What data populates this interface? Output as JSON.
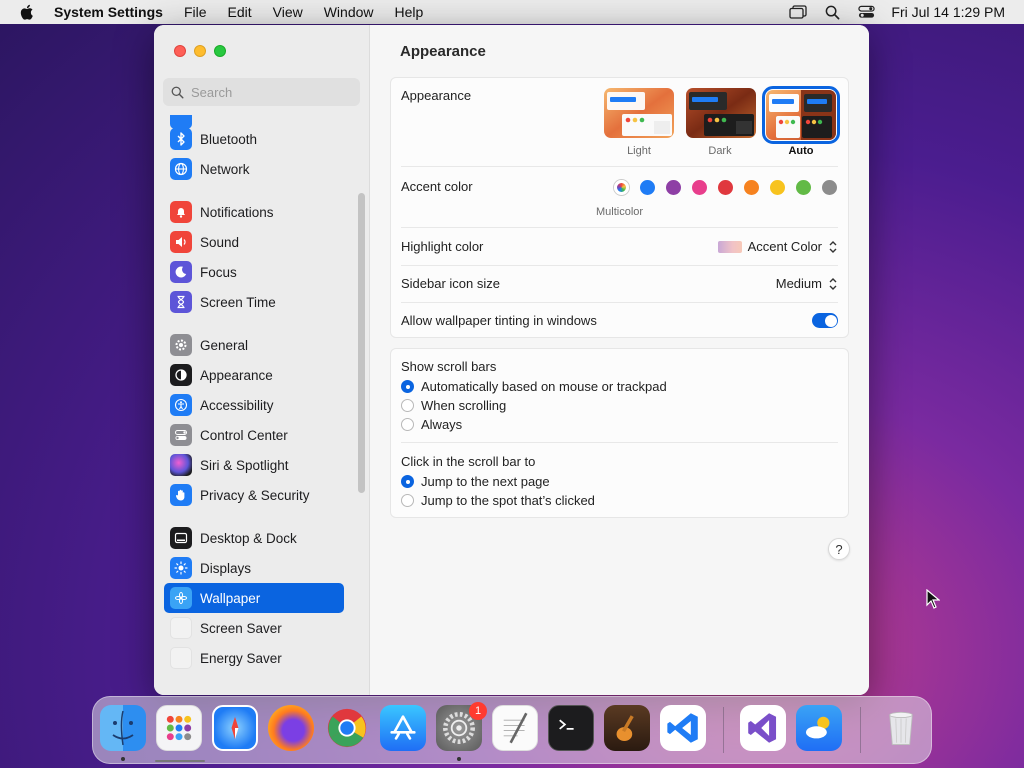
{
  "menubar": {
    "app_name": "System Settings",
    "menus": [
      "File",
      "Edit",
      "View",
      "Window",
      "Help"
    ],
    "clock": "Fri Jul 14  1:29 PM"
  },
  "sidebar": {
    "search_placeholder": "Search",
    "items": [
      {
        "label": "Bluetooth",
        "icon": "bluetooth-icon",
        "color": "#1f7cf5"
      },
      {
        "label": "Network",
        "icon": "globe-icon",
        "color": "#1f7cf5"
      },
      {
        "label": "Notifications",
        "icon": "bell-icon",
        "color": "#f0453a"
      },
      {
        "label": "Sound",
        "icon": "speaker-icon",
        "color": "#f0453a"
      },
      {
        "label": "Focus",
        "icon": "moon-icon",
        "color": "#5d55d8"
      },
      {
        "label": "Screen Time",
        "icon": "hourglass-icon",
        "color": "#5d55d8"
      },
      {
        "label": "General",
        "icon": "gear-icon",
        "color": "#8e8e93"
      },
      {
        "label": "Appearance",
        "icon": "appearance-icon",
        "color": "#1c1c1e"
      },
      {
        "label": "Accessibility",
        "icon": "accessibility-icon",
        "color": "#1f7cf5"
      },
      {
        "label": "Control Center",
        "icon": "control-center-icon",
        "color": "#8e8e93"
      },
      {
        "label": "Siri & Spotlight",
        "icon": "siri-icon",
        "color": "#2a2a2a"
      },
      {
        "label": "Privacy & Security",
        "icon": "hand-icon",
        "color": "#1f7cf5"
      },
      {
        "label": "Desktop & Dock",
        "icon": "desktop-icon",
        "color": "#1c1c1e"
      },
      {
        "label": "Displays",
        "icon": "sun-icon",
        "color": "#1f7cf5"
      },
      {
        "label": "Wallpaper",
        "icon": "wallpaper-icon",
        "color": "#3aa3f5"
      },
      {
        "label": "Screen Saver",
        "icon": "screen-saver-icon",
        "color": "#eaeaea"
      },
      {
        "label": "Energy Saver",
        "icon": "energy-saver-icon",
        "color": "#eaeaea"
      }
    ],
    "selected": "Wallpaper"
  },
  "main": {
    "title": "Appearance",
    "appearance": {
      "label": "Appearance",
      "options": [
        "Light",
        "Dark",
        "Auto"
      ],
      "selected": "Auto"
    },
    "accent": {
      "label": "Accent color",
      "colors": [
        "#1f7cf5",
        "#8e3fa5",
        "#e83e8c",
        "#e0383e",
        "#f6821f",
        "#f7c31e",
        "#62ba46",
        "#8c8c8c"
      ],
      "multicolor_caption": "Multicolor"
    },
    "highlight": {
      "label": "Highlight color",
      "value": "Accent Color"
    },
    "sidebar_icon_size": {
      "label": "Sidebar icon size",
      "value": "Medium"
    },
    "tinting": {
      "label": "Allow wallpaper tinting in windows",
      "enabled": true
    },
    "scroll_bars": {
      "label": "Show scroll bars",
      "options": [
        "Automatically based on mouse or trackpad",
        "When scrolling",
        "Always"
      ],
      "selected_index": 0
    },
    "click_scroll": {
      "label": "Click in the scroll bar to",
      "options": [
        "Jump to the next page",
        "Jump to the spot that’s clicked"
      ],
      "selected_index": 0
    },
    "help": "?"
  },
  "dock": {
    "apps": [
      "Finder",
      "Launchpad",
      "Safari",
      "Firefox",
      "Chrome",
      "App Store",
      "System Settings",
      "TextEdit",
      "Terminal",
      "GarageBand",
      "Visual Studio Code",
      "Visual Studio",
      "Weather",
      "Trash"
    ],
    "badge": "1"
  }
}
